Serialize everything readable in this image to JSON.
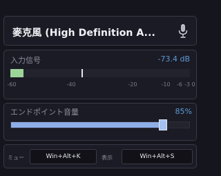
{
  "device": {
    "name": "麥克風 (High Definition A...",
    "icon": "microphone-icon"
  },
  "input_level": {
    "label": "入力信号",
    "value_text": "-73.4 dB",
    "level_db": -53,
    "peak_db": -33,
    "scale_min_db": -60,
    "scale_max_db": 0,
    "ticks": [
      {
        "text": "-60",
        "db": -60
      },
      {
        "text": "-40",
        "db": -40
      },
      {
        "text": "-20",
        "db": -20
      },
      {
        "text": "-10",
        "db": -10
      },
      {
        "text": "-6",
        "db": -6
      },
      {
        "text": "-3",
        "db": -3
      },
      {
        "text": "0",
        "db": 0
      }
    ],
    "meter_color": "#9dd49a"
  },
  "endpoint_volume": {
    "label": "エンドポイント音量",
    "value_text": "85%",
    "percent": 85,
    "accent": "#8eaee8"
  },
  "hotkeys": {
    "mute_label": "ミュー",
    "mute_key": "Win+Alt+K",
    "show_label": "表示",
    "show_key": "Win+Alt+S"
  },
  "colors": {
    "background": "#15151d",
    "panel": "#1b1b25",
    "value_blue": "#5b9bd5"
  }
}
